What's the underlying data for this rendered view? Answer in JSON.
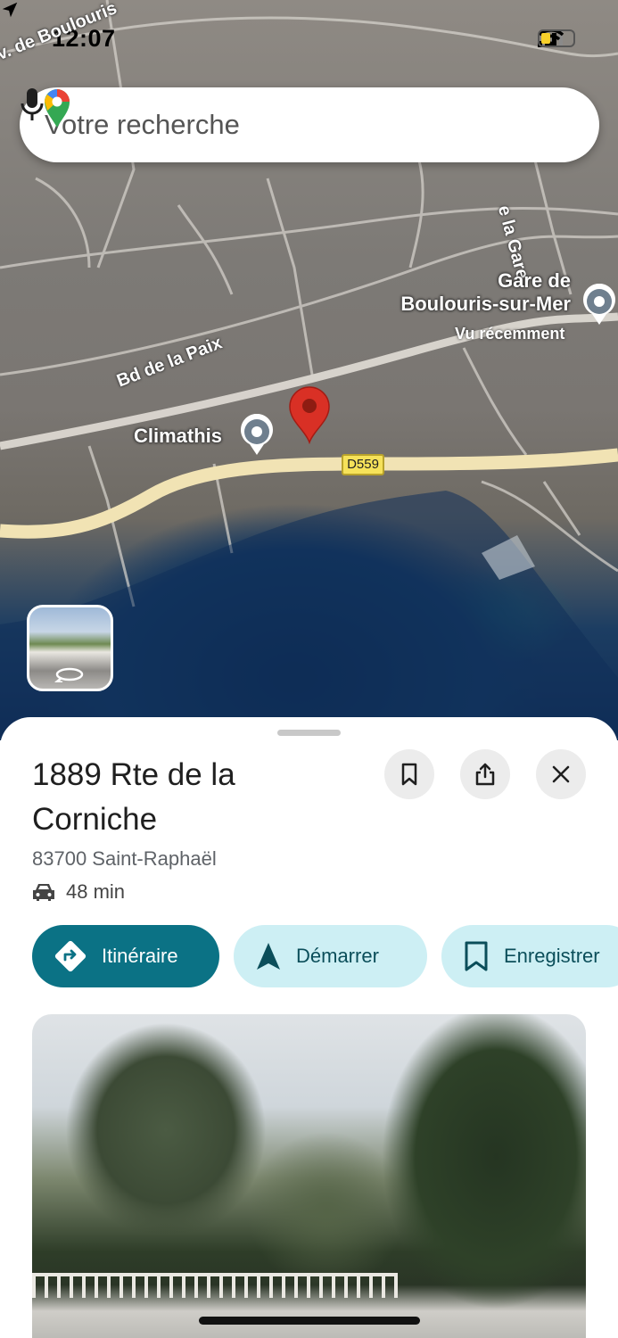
{
  "status_bar": {
    "time": "12:07",
    "icons": [
      "location-arrow-icon",
      "cellular-signal-icon",
      "wifi-icon",
      "battery-icon"
    ]
  },
  "search": {
    "placeholder": "Votre recherche",
    "icons": [
      "google-maps-logo",
      "mic-icon"
    ]
  },
  "map": {
    "road_labels": {
      "top_left": "v. de Boulouris",
      "paix": "Bd de la Paix",
      "gare": "e la Gare"
    },
    "route_shield": "D559",
    "pois": [
      {
        "name": "Gare de",
        "name2": "Boulouris-sur-Mer",
        "sub": "Vu récemment"
      },
      {
        "name": "Climathis"
      }
    ]
  },
  "place": {
    "title": "1889 Rte de la Corniche",
    "address": "83700 Saint-Raphaël",
    "drive_time": "48 min",
    "actions": {
      "directions": "Itinéraire",
      "start": "Démarrer",
      "save": "Enregistrer"
    }
  },
  "colors": {
    "primary": "#0b7285",
    "chip_secondary": "#cdeff4",
    "pin": "#d93025"
  }
}
